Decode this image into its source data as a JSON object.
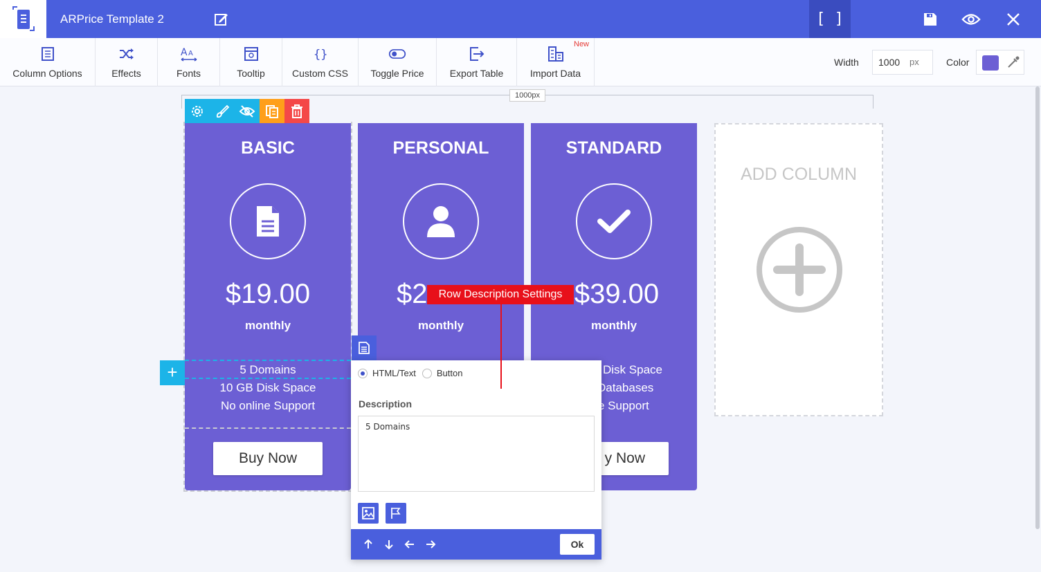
{
  "app": {
    "title": "ARPrice Template 2",
    "fullscreen_label": "[ ]"
  },
  "toolbar": {
    "items": [
      {
        "label": "Column Options",
        "icon": "column-options-icon"
      },
      {
        "label": "Effects",
        "icon": "shuffle-icon"
      },
      {
        "label": "Fonts",
        "icon": "font-size-icon"
      },
      {
        "label": "Tooltip",
        "icon": "tooltip-icon"
      },
      {
        "label": "Custom CSS",
        "icon": "braces-icon"
      },
      {
        "label": "Toggle Price",
        "icon": "toggle-icon"
      },
      {
        "label": "Export Table",
        "icon": "export-icon"
      },
      {
        "label": "Import Data",
        "icon": "import-icon"
      }
    ],
    "new_badge": "New",
    "width_label": "Width",
    "width_value": "1000",
    "width_unit": "px",
    "color_label": "Color",
    "color_value": "#6c5fd4"
  },
  "canvas": {
    "ruler_label": "1000px",
    "columns": [
      {
        "title": "BASIC",
        "icon": "document-icon",
        "price": "$19.00",
        "period": "monthly",
        "features": [
          "5 Domains",
          "10 GB Disk Space",
          "No online Support"
        ],
        "button": "Buy Now"
      },
      {
        "title": "PERSONAL",
        "icon": "user-icon",
        "price": "$2",
        "period": "monthly",
        "features": [],
        "button": ""
      },
      {
        "title": "STANDARD",
        "icon": "check-icon",
        "price": "$39.00",
        "period": "monthly",
        "features": [
          "Disk Space",
          "Databases",
          "e Support"
        ],
        "button": "y Now"
      }
    ],
    "add_column_label": "ADD COLUMN"
  },
  "popup": {
    "type_options": [
      "HTML/Text",
      "Button"
    ],
    "selected_type": "HTML/Text",
    "description_label": "Description",
    "description_value": "5 Domains",
    "ok_label": "Ok"
  },
  "annotation": {
    "text": "Row Description Settings"
  },
  "colors": {
    "brand": "#4a5fdd",
    "column": "#6c5fd4",
    "accent": "#1cb4e8",
    "callout": "#e8101a"
  }
}
